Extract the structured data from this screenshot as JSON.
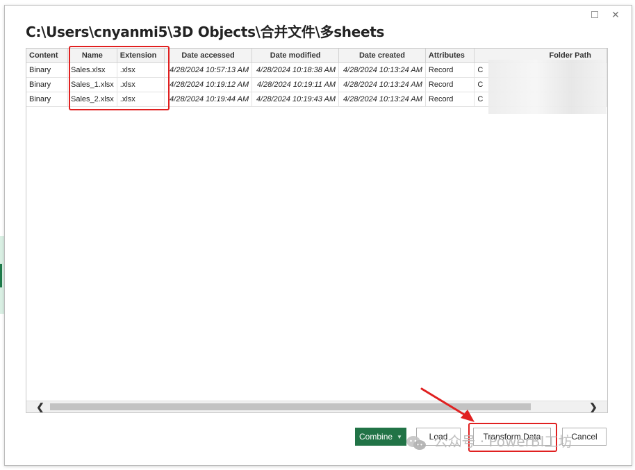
{
  "dialog": {
    "title": "C:\\Users\\cnyanmi5\\3D Objects\\合并文件\\多sheets",
    "close_glyph": "✕"
  },
  "table": {
    "columns": [
      "Content",
      "Name",
      "Extension",
      "Date accessed",
      "Date modified",
      "Date created",
      "Attributes",
      "Folder Path"
    ],
    "rows": [
      [
        "Binary",
        "Sales.xlsx",
        ".xlsx",
        "4/28/2024 10:57:13 AM",
        "4/28/2024 10:18:38 AM",
        "4/28/2024 10:13:24 AM",
        "Record",
        "C"
      ],
      [
        "Binary",
        "Sales_1.xlsx",
        ".xlsx",
        "4/28/2024 10:19:12 AM",
        "4/28/2024 10:19:11 AM",
        "4/28/2024 10:13:24 AM",
        "Record",
        "C"
      ],
      [
        "Binary",
        "Sales_2.xlsx",
        ".xlsx",
        "4/28/2024 10:19:44 AM",
        "4/28/2024 10:19:43 AM",
        "4/28/2024 10:13:24 AM",
        "Record",
        "C"
      ]
    ]
  },
  "scrollbar": {
    "left_glyph": "❮",
    "right_glyph": "❯"
  },
  "buttons": {
    "combine": "Combine",
    "combine_chevron": "▼",
    "load": "Load",
    "transform": "Transform Data",
    "cancel": "Cancel"
  },
  "watermark": {
    "text": "公众号 · PowerBI工坊"
  },
  "colors": {
    "accent_green": "#217346",
    "highlight_red": "#e02020"
  },
  "icons": {
    "close": "close-icon",
    "maximize": "maximize-icon",
    "chevron": "chevron-down-icon",
    "wechat": "wechat-icon"
  }
}
